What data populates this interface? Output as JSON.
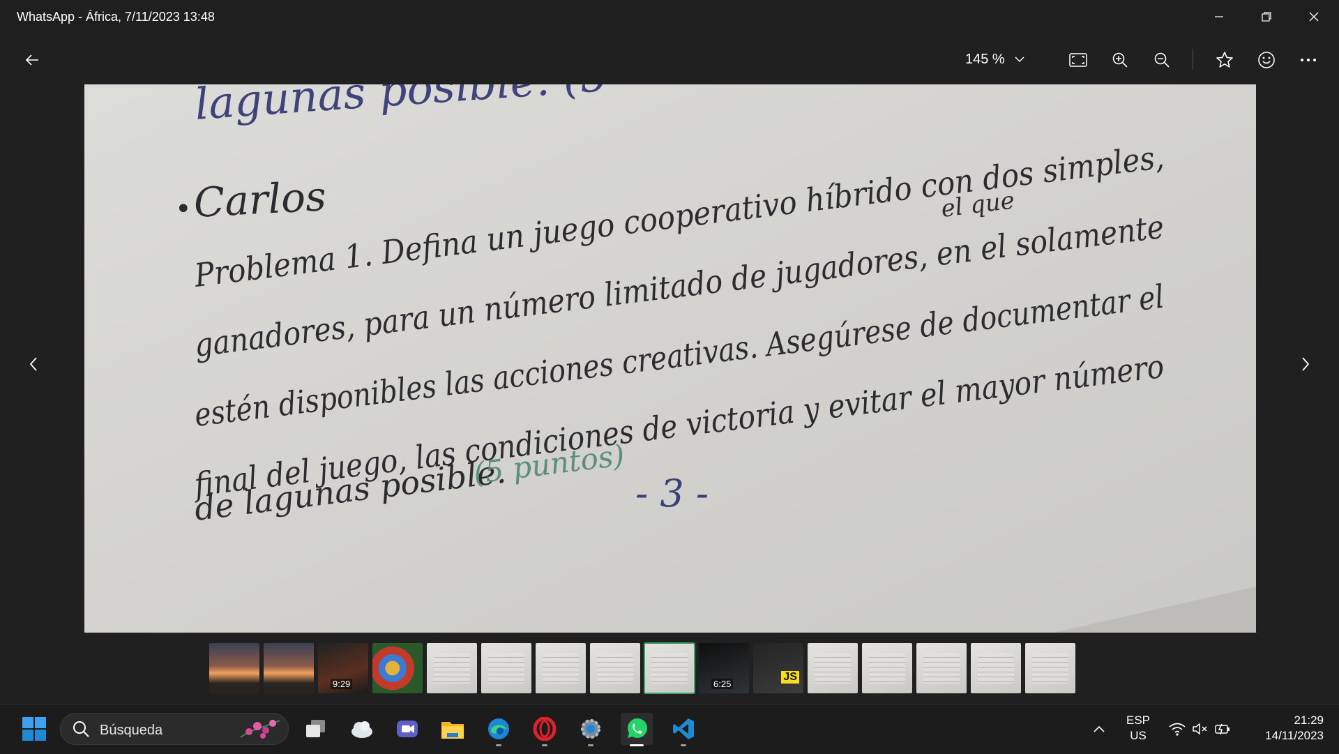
{
  "window": {
    "title": "WhatsApp - África, 7/11/2023 13:48"
  },
  "toolbar": {
    "zoom_level": "145 %"
  },
  "image": {
    "handwriting": {
      "top_fragment": "lagunas posible. (5",
      "bullet": "•",
      "name": "Carlos",
      "line1": "Problema 1. Defina un juego cooperativo híbrido con dos simples,",
      "insert": "el que",
      "line2": "ganadores, para un número limitado de jugadores, en el solamente",
      "line3": "estén disponibles las acciones creativas. Asegúrese de documentar el",
      "line4": "final del juego, las condiciones de victoria y evitar el mayor número",
      "line5": "de lagunas posible.",
      "points": "(5 puntos)",
      "page_number": "- 3 -"
    }
  },
  "filmstrip": {
    "thumbs": [
      {
        "kind": "sunset",
        "label": ""
      },
      {
        "kind": "sunset",
        "label": ""
      },
      {
        "kind": "video",
        "label": "9:29"
      },
      {
        "kind": "poster",
        "label": ""
      },
      {
        "kind": "paper",
        "label": ""
      },
      {
        "kind": "paper",
        "label": ""
      },
      {
        "kind": "paper",
        "label": ""
      },
      {
        "kind": "paper",
        "label": ""
      },
      {
        "kind": "paper",
        "label": "",
        "selected": true
      },
      {
        "kind": "dark",
        "label": "6:25"
      },
      {
        "kind": "js",
        "label": "JS"
      },
      {
        "kind": "paper",
        "label": ""
      },
      {
        "kind": "paper",
        "label": ""
      },
      {
        "kind": "paper",
        "label": ""
      },
      {
        "kind": "paper",
        "label": ""
      },
      {
        "kind": "paper",
        "label": ""
      }
    ]
  },
  "taskbar": {
    "search_placeholder": "Búsqueda",
    "lang_line1": "ESP",
    "lang_line2": "US",
    "time": "21:29",
    "date": "14/11/2023",
    "apps": [
      "start-icon",
      "task-view-icon",
      "weather-icon",
      "teams-icon",
      "file-explorer-icon",
      "edge-icon",
      "opera-icon",
      "settings-icon",
      "whatsapp-icon",
      "vscode-icon"
    ]
  },
  "colors": {
    "accent": "#3aa36a",
    "ink_blue": "#3b3f7a",
    "ink_green": "#5a8f7a",
    "ink_pencil": "#2c2c30"
  }
}
